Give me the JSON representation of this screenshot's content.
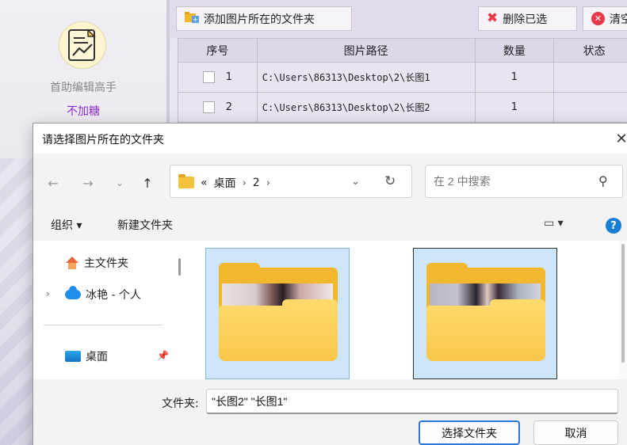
{
  "app": {
    "name": "首助编辑高手",
    "link": "不加糖"
  },
  "toolbar": {
    "add_folder_label": "添加图片所在的文件夹",
    "delete_selected_label": "删除已选",
    "clear_label": "清空"
  },
  "grid": {
    "columns": [
      "序号",
      "图片路径",
      "数量",
      "状态"
    ],
    "rows": [
      {
        "index": "1",
        "path": "C:\\Users\\86313\\Desktop\\2\\长图1",
        "count": "1",
        "status": ""
      },
      {
        "index": "2",
        "path": "C:\\Users\\86313\\Desktop\\2\\长图2",
        "count": "1",
        "status": ""
      }
    ]
  },
  "dialog": {
    "title": "请选择图片所在的文件夹",
    "close_glyph": "✕",
    "address": {
      "overflow": "«",
      "crumbs": [
        "桌面",
        "2"
      ],
      "separator": "›"
    },
    "search_placeholder": "在 2 中搜索",
    "commands": {
      "organize": "组织 ▾",
      "new_folder": "新建文件夹",
      "view": "▭ ▾",
      "help": "?"
    },
    "nav_pane": {
      "home": "主文件夹",
      "cloud": "冰艳 - 个人",
      "desktop": "桌面"
    },
    "footer": {
      "filename_label": "文件夹:",
      "filename_value": "\"长图2\" \"长图1\"",
      "select_button": "选择文件夹",
      "cancel_button": "取消"
    }
  },
  "colors": {
    "accent": "#2b78d6",
    "link": "#8a2fd1",
    "danger": "#e8384a",
    "folder": "#f1b72e",
    "selection": "#cde6fa"
  }
}
